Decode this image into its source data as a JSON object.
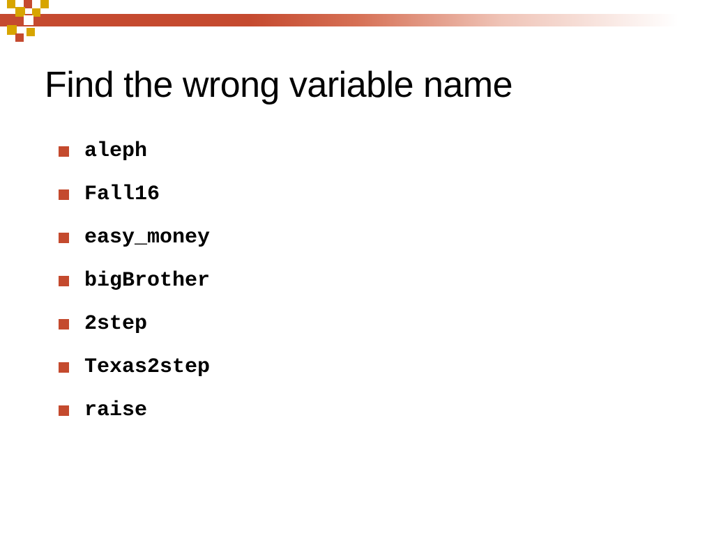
{
  "title": "Find the wrong variable name",
  "items": [
    "aleph",
    "Fall16",
    "easy_money",
    "bigBrother",
    "2step",
    "Texas2step",
    "raise"
  ],
  "colors": {
    "accent": "#c44a2e",
    "gold": "#d7a500"
  }
}
